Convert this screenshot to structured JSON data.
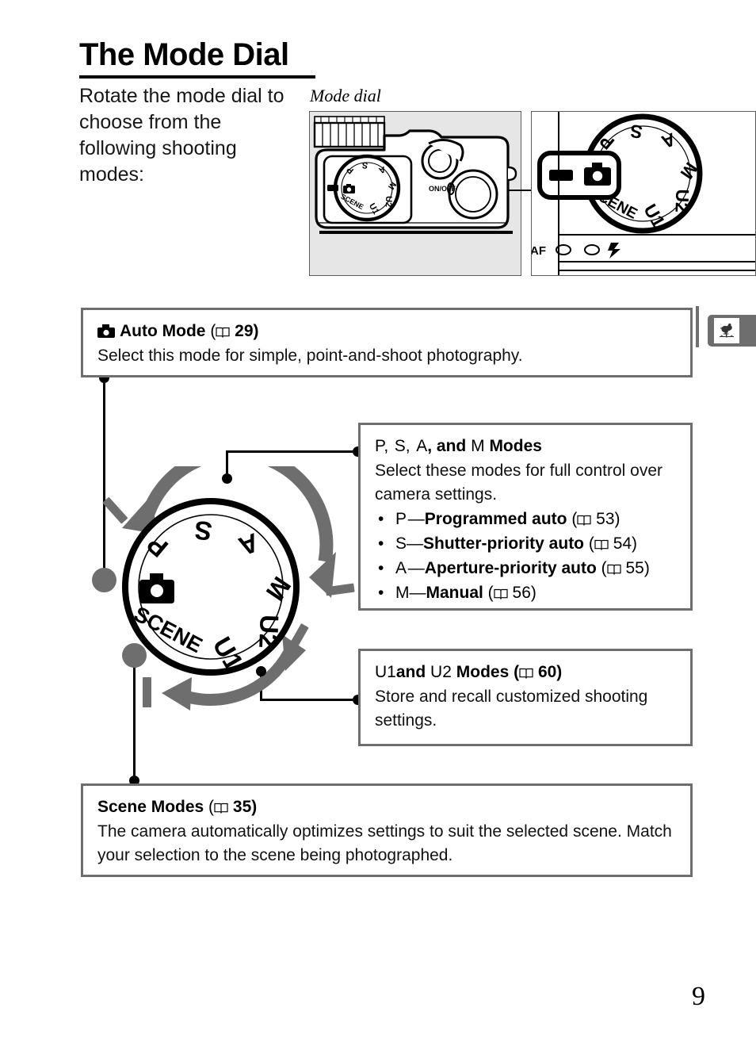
{
  "document": {
    "title": "The Mode Dial",
    "page_number": "9",
    "intro_paragraph": "Rotate the mode dial to choose from the following shooting modes:"
  },
  "illustration": {
    "caption": "Mode dial",
    "camera_panel_name": "camera-top-view",
    "dial_panel_name": "mode-dial-closeup",
    "power_switch_label": "ON/OFF",
    "bottom_labels": [
      "AF"
    ],
    "dial_positions": [
      {
        "label": "P",
        "angle": -50
      },
      {
        "label": "S",
        "angle": -18
      },
      {
        "label": "A",
        "angle": 16
      },
      {
        "label": "M",
        "angle": 52
      },
      {
        "label": "U2",
        "angle": 88
      },
      {
        "label": "U1",
        "angle": 120
      },
      {
        "label": "SCENE",
        "angle": 152
      },
      {
        "label": "camera-icon",
        "angle": 184
      }
    ]
  },
  "boxes": {
    "auto": {
      "icon": "camera-icon",
      "title": "Auto Mode",
      "page_ref": "29",
      "body": "Select this mode for simple, point-and-shoot photography."
    },
    "psam": {
      "title_parts": {
        "p": "P",
        "s": "S",
        "a": "A",
        "and": "and",
        "m": "M",
        "modes": "Modes"
      },
      "title": "P, S, A, and M Modes",
      "body": "Select these modes for full control over camera settings.",
      "items": [
        {
          "code": "P",
          "name": "Programmed auto",
          "page_ref": "53"
        },
        {
          "code": "S",
          "name": "Shutter-priority auto",
          "page_ref": "54"
        },
        {
          "code": "A",
          "name": "Aperture-priority auto",
          "page_ref": "55"
        },
        {
          "code": "M",
          "name": "Manual",
          "page_ref": "56"
        }
      ]
    },
    "u12": {
      "title_parts": {
        "u1": "U1",
        "and": "and",
        "u2": "U2",
        "modes": "Modes"
      },
      "title": "U1 and U2 Modes",
      "page_ref": "60",
      "body": "Store and recall customized shooting settings."
    },
    "scene": {
      "title": "Scene Modes",
      "page_ref": "35",
      "body": "The camera automatically optimizes settings to suit the selected scene. Match your selection to the scene being photographed."
    }
  },
  "side_tab": {
    "icon": "weathervane-rooster-icon",
    "name": "chapter-tab"
  },
  "colors": {
    "box_border": "#6e6e6e",
    "arrow_gray": "#6e6e6e",
    "panel_bg": "#e6e6e6",
    "text": "#000000"
  }
}
